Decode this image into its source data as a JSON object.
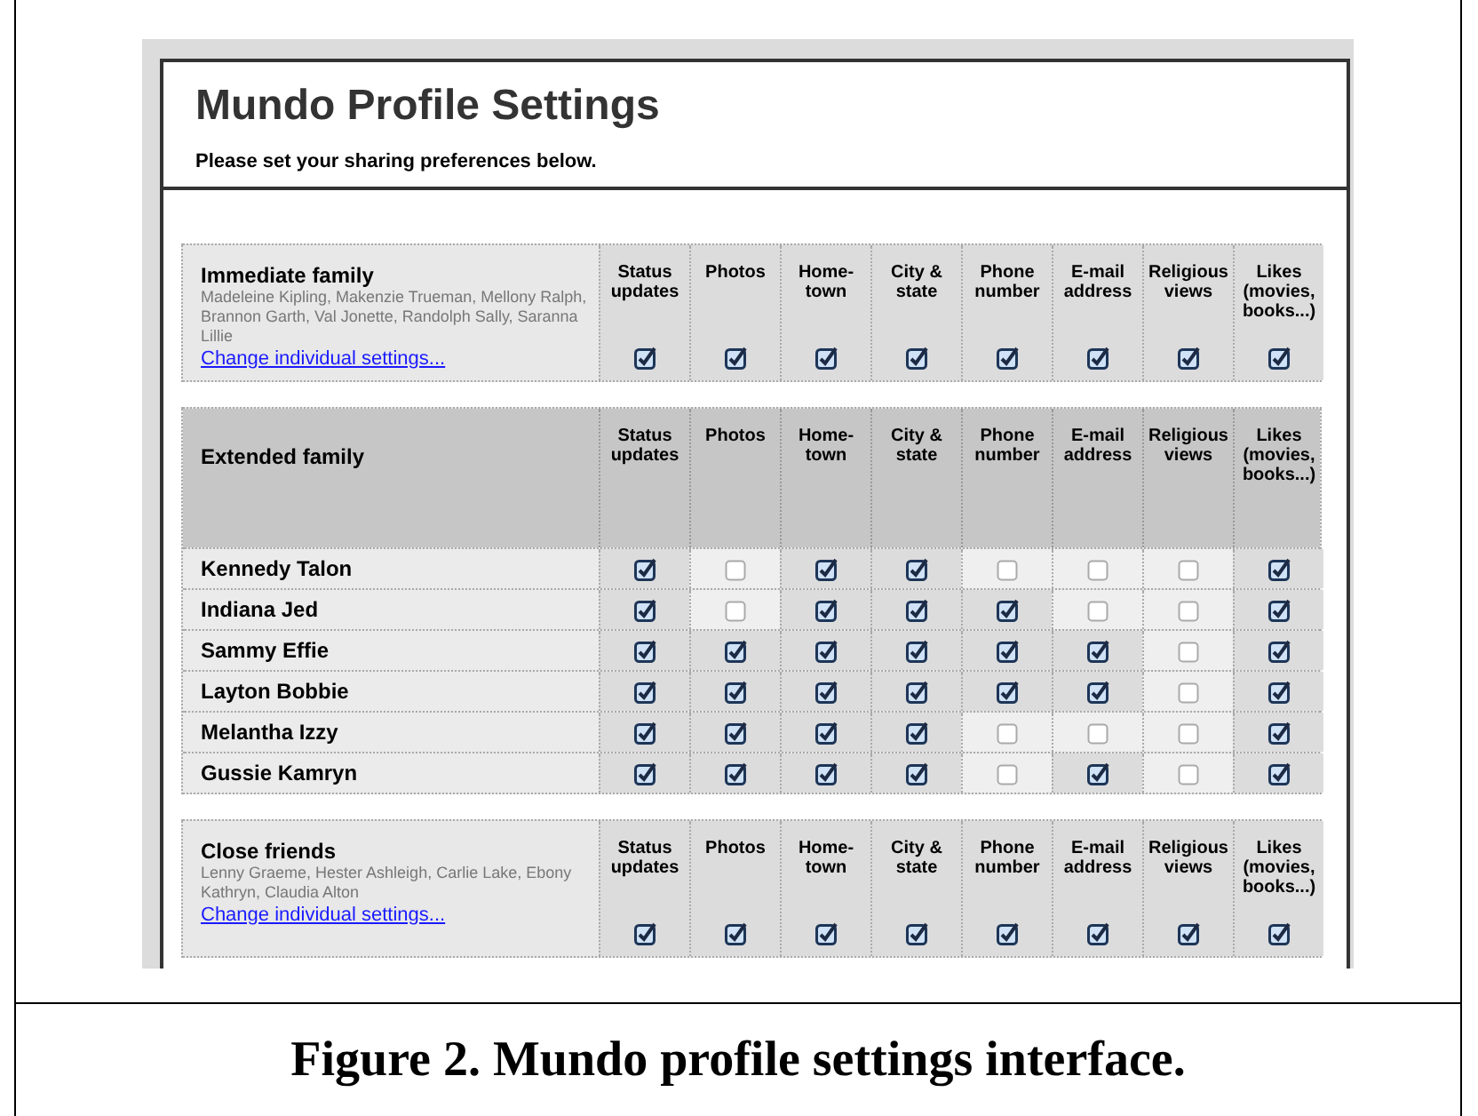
{
  "title": "Mundo Profile Settings",
  "subtitle": "Please set your sharing preferences below.",
  "sections": [
    {
      "kind": "group",
      "name": "Immediate family",
      "members": "Madeleine Kipling, Makenzie Trueman, Mellony Ralph, Brannon Garth, Val Jonette, Randolph Sally, Saranna Lillie",
      "link": "Change individual settings...",
      "columns": [
        "Status updates",
        "Photos",
        "Home-town",
        "City & state",
        "Phone number",
        "E-mail address",
        "Religious views",
        "Likes (movies, books...)"
      ],
      "settings": [
        true,
        true,
        true,
        true,
        true,
        true,
        true,
        true
      ]
    },
    {
      "kind": "list",
      "name": "Extended family",
      "columns": [
        "Status updates",
        "Photos",
        "Home-town",
        "City & state",
        "Phone number",
        "E-mail address",
        "Religious views",
        "Likes (movies, books...)"
      ],
      "rows": [
        {
          "name": "Kennedy Talon",
          "settings": [
            true,
            false,
            true,
            true,
            false,
            false,
            false,
            true
          ]
        },
        {
          "name": "Indiana Jed",
          "settings": [
            true,
            false,
            true,
            true,
            true,
            false,
            false,
            true
          ]
        },
        {
          "name": "Sammy Effie",
          "settings": [
            true,
            true,
            true,
            true,
            true,
            true,
            false,
            true
          ]
        },
        {
          "name": "Layton Bobbie",
          "settings": [
            true,
            true,
            true,
            true,
            true,
            true,
            false,
            true
          ]
        },
        {
          "name": "Melantha Izzy",
          "settings": [
            true,
            true,
            true,
            true,
            false,
            false,
            false,
            true
          ]
        },
        {
          "name": "Gussie Kamryn",
          "settings": [
            true,
            true,
            true,
            true,
            false,
            true,
            false,
            true
          ]
        }
      ]
    },
    {
      "kind": "group",
      "name": "Close friends",
      "members": "Lenny Graeme, Hester Ashleigh, Carlie Lake, Ebony Kathryn, Claudia Alton",
      "link": "Change individual settings...",
      "columns": [
        "Status updates",
        "Photos",
        "Home-town",
        "City & state",
        "Phone number",
        "E-mail address",
        "Religious views",
        "Likes (movies, books...)"
      ],
      "settings": [
        true,
        true,
        true,
        true,
        true,
        true,
        true,
        true
      ]
    }
  ],
  "caption": "Figure 2. Mundo profile settings interface."
}
